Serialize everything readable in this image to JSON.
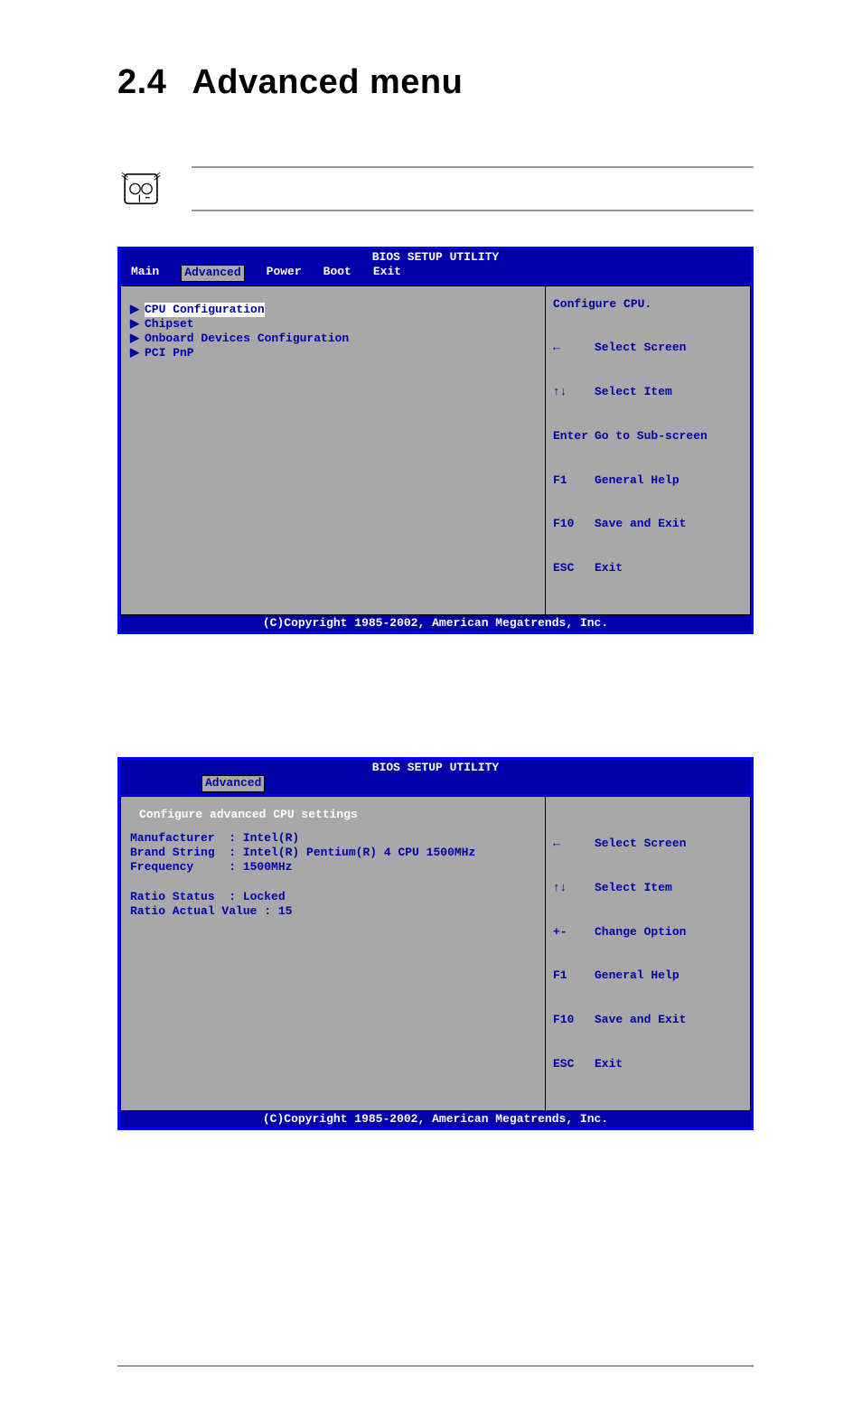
{
  "page": {
    "section_number": "2.4",
    "section_title": "Advanced menu"
  },
  "bios1": {
    "title": "BIOS SETUP UTILITY",
    "tabs": [
      "Main",
      "Advanced",
      "Power",
      "Boot",
      "Exit"
    ],
    "selected_tab": "Advanced",
    "menu": [
      "CPU Configuration",
      "Chipset",
      "Onboard Devices Configuration",
      "PCI PnP"
    ],
    "help_top": "Configure CPU.",
    "keys": [
      {
        "k": "←",
        "d": "Select Screen"
      },
      {
        "k": "↑↓",
        "d": "Select Item"
      },
      {
        "k": "Enter",
        "d": "Go to Sub-screen"
      },
      {
        "k": "F1",
        "d": "General Help"
      },
      {
        "k": "F10",
        "d": "Save and Exit"
      },
      {
        "k": "ESC",
        "d": "Exit"
      }
    ],
    "footer": "(C)Copyright 1985-2002, American Megatrends, Inc."
  },
  "bios2": {
    "title": "BIOS SETUP UTILITY",
    "selected_tab": "Advanced",
    "section_heading": "Configure advanced CPU settings",
    "info": {
      "Manufacturer": "Intel(R)",
      "Brand String": "Intel(R) Pentium(R) 4 CPU 1500MHz",
      "Frequency": "1500MHz",
      "Ratio Status": "Locked",
      "Ratio Actual Value": "15"
    },
    "keys": [
      {
        "k": "←",
        "d": "Select Screen"
      },
      {
        "k": "↑↓",
        "d": "Select Item"
      },
      {
        "k": "+-",
        "d": "Change Option"
      },
      {
        "k": "F1",
        "d": "General Help"
      },
      {
        "k": "F10",
        "d": "Save and Exit"
      },
      {
        "k": "ESC",
        "d": "Exit"
      }
    ],
    "footer": "(C)Copyright 1985-2002, American Megatrends, Inc."
  }
}
